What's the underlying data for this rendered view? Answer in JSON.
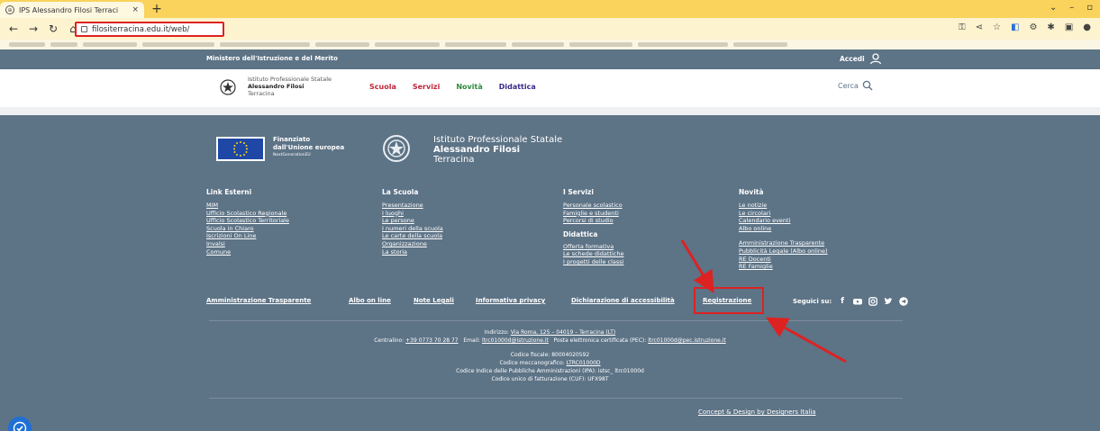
{
  "browser": {
    "tab_title": "IPS Alessandro Filosi Terraci",
    "tab_close": "×",
    "new_tab": "+",
    "url": "filositerracina.edu.it/web/"
  },
  "topbar": {
    "ministry": "Ministero dell'Istruzione e del Merito",
    "login": "Accedi"
  },
  "header": {
    "logo_line1": "Istituto Professionale Statale",
    "logo_line2": "Alessandro Filosi",
    "logo_line3": "Terracina",
    "nav": [
      {
        "label": "Scuola",
        "color": "#c0273a"
      },
      {
        "label": "Servizi",
        "color": "#c0273a"
      },
      {
        "label": "Novità",
        "color": "#2b8a3e"
      },
      {
        "label": "Didattica",
        "color": "#3b2a8c"
      }
    ],
    "search": "Cerca"
  },
  "footer": {
    "eu_line1": "Finanziato",
    "eu_line2": "dall'Unione europea",
    "eu_line3": "NextGenerationEU",
    "school_line1": "Istituto Professionale Statale",
    "school_line2": "Alessandro Filosi",
    "school_line3": "Terracina",
    "columns": [
      {
        "title": "Link Esterni",
        "links": [
          "MIM",
          "Ufficio Scolastico Regionale",
          "Ufficio Scolastico Territoriale",
          "Scuola in Chiaro",
          "Iscrizioni On Line",
          "Invalsi",
          "Comune"
        ]
      },
      {
        "title": "La Scuola",
        "links": [
          "Presentazione",
          "I luoghi",
          "Le persone",
          "I numeri della scuola",
          "Le carte della scuola",
          "Organizzazione",
          "La storia"
        ]
      },
      {
        "title": "I Servizi",
        "links": [
          "Personale scolastico",
          "Famiglie e studenti",
          "Percorsi di studio"
        ],
        "subtitle": "Didattica",
        "sublinks": [
          "Offerta formativa",
          "Le schede didattiche",
          "I progetti delle classi"
        ]
      },
      {
        "title": "Novità",
        "links": [
          "Le notizie",
          "Le circolari",
          "Calendario eventi",
          "Albo online"
        ],
        "links2": [
          "Amministrazione Trasparente",
          "Pubblicità Legale (Albo online)",
          "RE Docenti",
          "RE Famiglie"
        ]
      }
    ],
    "bottom_links": [
      "Amministrazione Trasparente",
      "Albo on line",
      "Note Legali",
      "Informativa privacy",
      "Dichiarazione di accessibilità",
      "Registrazione"
    ],
    "follow": "Seguici su:",
    "social_icons": [
      "facebook-icon",
      "youtube-icon",
      "instagram-icon",
      "twitter-icon",
      "telegram-icon"
    ],
    "address_prefix": "Indirizzo: ",
    "address": "Via Roma, 125 – 04019 – Terracina (LT)",
    "phone_prefix": "Centralino: ",
    "phone": "+39 0773 70 28 77",
    "email_prefix": "Email: ",
    "email": "ltrc01000d@istruzione.it",
    "pec_prefix": "Posta elettronica certificata (PEC): ",
    "pec": "ltrc01000d@pec.istruzione.it",
    "fiscal": "Codice fiscale: 80004020592",
    "mecc_prefix": "Codice meccanografico: ",
    "mecc": "LTRC01000D",
    "ipa": "Codice Indice delle Pubbliche Amministrazioni (IPA): istsc_ ltrc01000d",
    "cuf": "Codice unico di fatturazione (CUF): UFX98T",
    "credits": "Concept & Design by Designers Italia"
  },
  "colors": {
    "site_slate": "#5d7386",
    "browser_yellow": "#f9d35c",
    "annotation_red": "#dd2222"
  }
}
